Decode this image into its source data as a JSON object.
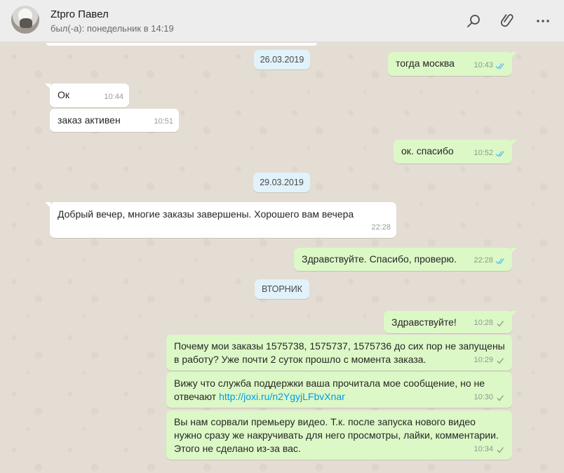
{
  "header": {
    "contact_name": "Ztpro Павел",
    "status": "был(-а): понедельник в 14:19",
    "icons": [
      "search-icon",
      "attach-icon",
      "menu-icon"
    ]
  },
  "colors": {
    "incoming": "#ffffff",
    "outgoing": "#dcf8c6",
    "date_badge": "#e1f2fa",
    "read_ticks": "#4fc3f7",
    "sent_ticks": "#8b9a8b",
    "link": "#039be5"
  },
  "chat": {
    "dates": [
      "26.03.2019",
      "29.03.2019",
      "ВТОРНИК"
    ],
    "messages": [
      {
        "dir": "out",
        "text": "тогда москва",
        "time": "10:43",
        "status": "read"
      },
      {
        "dir": "in",
        "text": "Ок",
        "time": "10:44"
      },
      {
        "dir": "in",
        "text": "заказ активен",
        "time": "10:51"
      },
      {
        "dir": "out",
        "text": "ок. спасибо",
        "time": "10:52",
        "status": "read"
      },
      {
        "dir": "in",
        "text": "Добрый вечер, многие заказы завершены. Хорошего вам вечера",
        "time": "22:28"
      },
      {
        "dir": "out",
        "text": "Здравствуйте. Спасибо, проверю.",
        "time": "22:28",
        "status": "read"
      },
      {
        "dir": "out",
        "text": "Здравствуйте!",
        "time": "10:28",
        "status": "sent"
      },
      {
        "dir": "out",
        "text": "Почему мои заказы 1575738, 1575737, 1575736 до сих пор не запущены\nв работу?  Уже почти 2 суток прошло с момента заказа.",
        "time": "10:29",
        "status": "sent"
      },
      {
        "dir": "out",
        "text_before": "Вижу что служба поддержки ваша прочитала мое сообщение, но не\nотвечают ",
        "link": "http://joxi.ru/n2YgyjLFbvXnar",
        "time": "10:30",
        "status": "sent"
      },
      {
        "dir": "out",
        "text": "Вы нам сорвали премьеру видео. Т.к. после запуска нового видео\nнужно сразу же накручивать для него просмотры, лайки, комментарии.\nЭтого не сделано из-за вас.",
        "time": "10:34",
        "status": "sent"
      }
    ]
  }
}
